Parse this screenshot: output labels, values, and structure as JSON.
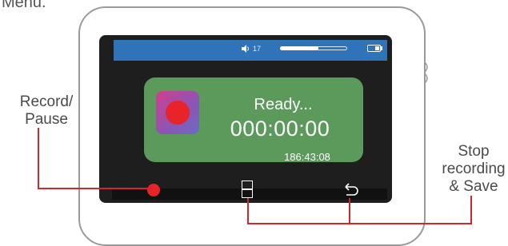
{
  "menu_caption": "Menu.",
  "callouts": {
    "record_pause_line1": "Record/",
    "record_pause_line2": "Pause",
    "stop_save_line1": "Stop",
    "stop_save_line2": "recording",
    "stop_save_line3": "& Save"
  },
  "status_bar": {
    "volume": "17",
    "volume_level": 0.57,
    "speaker_icon": "speaker-icon",
    "battery_icon": "battery-icon"
  },
  "recorder": {
    "status": "Ready...",
    "elapsed": "000:00:00",
    "remaining": "186:43:08",
    "record_icon": "record-icon"
  },
  "buttons": {
    "record_pause_icon": "record-dot-icon",
    "save_icon": "save-rectangle-icon",
    "back_icon": "return-arrow-icon"
  },
  "colors": {
    "status_bar": "#2f73b8",
    "panel": "#5b9a5b",
    "accent_red": "#e8232a",
    "callout_line": "#d0272b"
  }
}
